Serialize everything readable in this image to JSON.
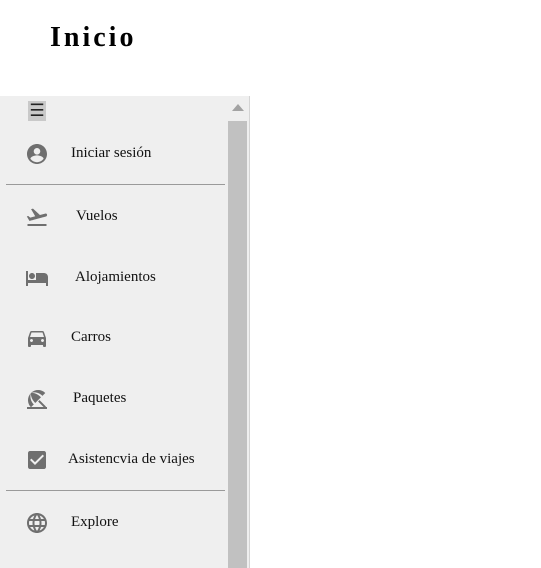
{
  "page": {
    "title": "Inicio"
  },
  "sidebar": {
    "menu_icon": "hamburger-menu-icon",
    "menu_glyph": "☰",
    "items": [
      {
        "label": "Iniciar sesión",
        "icon": "account-circle-icon"
      },
      {
        "label": "Vuelos",
        "icon": "flight-takeoff-icon"
      },
      {
        "label": "Alojamientos",
        "icon": "hotel-bed-icon"
      },
      {
        "label": "Carros",
        "icon": "car-icon"
      },
      {
        "label": "Paquetes",
        "icon": "beach-umbrella-icon"
      },
      {
        "label": "Asistencvia de viajes",
        "icon": "checkbox-icon"
      },
      {
        "label": "Explore",
        "icon": "globe-icon"
      }
    ]
  },
  "colors": {
    "sidebar_bg": "#efefef",
    "icon": "#6f6f6f",
    "divider": "#9a9a9a",
    "scroll_thumb": "#c1c1c1"
  }
}
